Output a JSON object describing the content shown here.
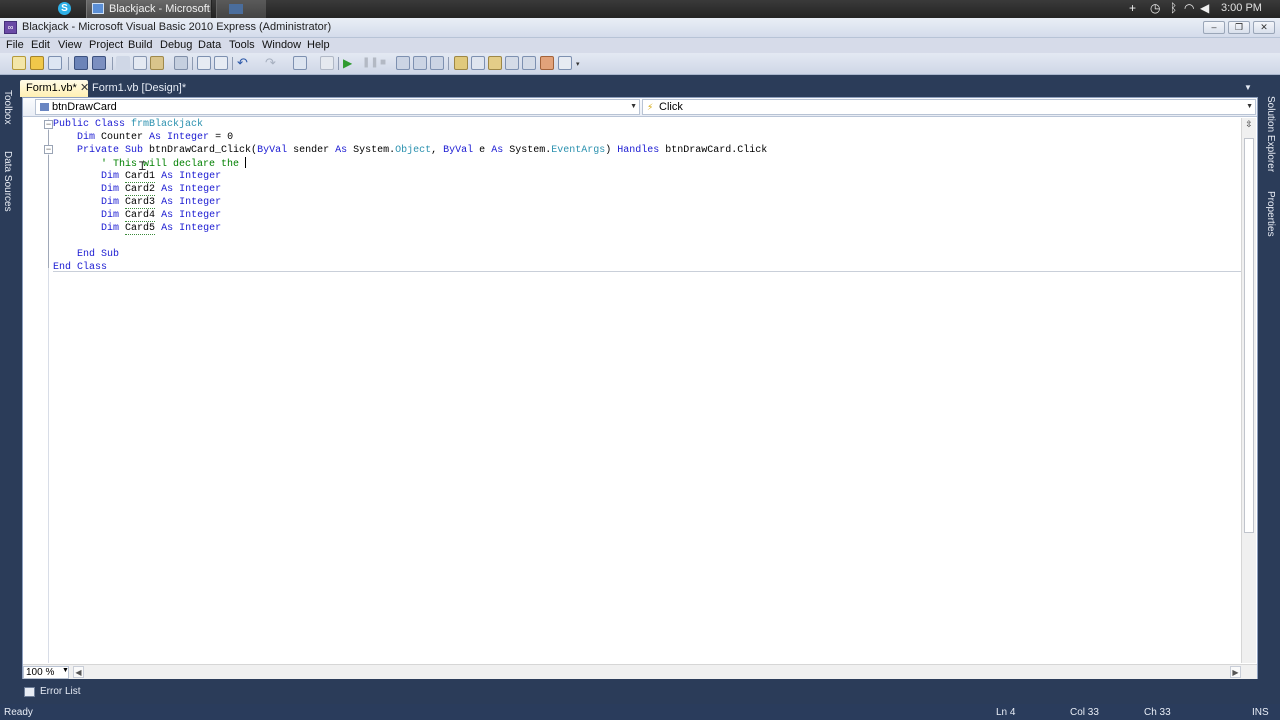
{
  "mac_bar": {
    "task_title": "Blackjack - Microsoft...",
    "clock": "3:00 PM"
  },
  "window": {
    "title": "Blackjack - Microsoft Visual Basic 2010 Express (Administrator)",
    "min": "–",
    "max": "❐",
    "close": "✕"
  },
  "menu": {
    "items": [
      "File",
      "Edit",
      "View",
      "Project",
      "Build",
      "Debug",
      "Data",
      "Tools",
      "Window",
      "Help"
    ]
  },
  "side_tabs": {
    "left": [
      "Toolbox",
      "Data Sources"
    ],
    "right": [
      "Solution Explorer",
      "Properties"
    ]
  },
  "tabs": [
    {
      "label": "Form1.vb*",
      "close": "✕"
    },
    {
      "label": "Form1.vb [Design]*"
    }
  ],
  "nav": {
    "object": "btnDrawCard",
    "event": "Click"
  },
  "code_lines": [
    "Public Class frmBlackjack",
    "Dim Counter As Integer = 0",
    "Private Sub btnDrawCard_Click(ByVal sender As System.Object, ByVal e As System.EventArgs) Handles btnDrawCard.Click",
    "' This will declare the ",
    "Dim Card1 As Integer",
    "Dim Card2 As Integer",
    "Dim Card3 As Integer",
    "Dim Card4 As Integer",
    "Dim Card5 As Integer",
    "End Sub",
    "End Class"
  ],
  "zoom": "100 %",
  "bottom": {
    "error_list": "Error List"
  },
  "status": {
    "ready": "Ready",
    "ln": "Ln 4",
    "col": "Col 33",
    "ch": "Ch 33",
    "ins": "INS"
  },
  "colors": {
    "keyword": "#1b1bd2",
    "type": "#2b91af",
    "comment": "#008000",
    "chrome": "#2b3c59"
  }
}
